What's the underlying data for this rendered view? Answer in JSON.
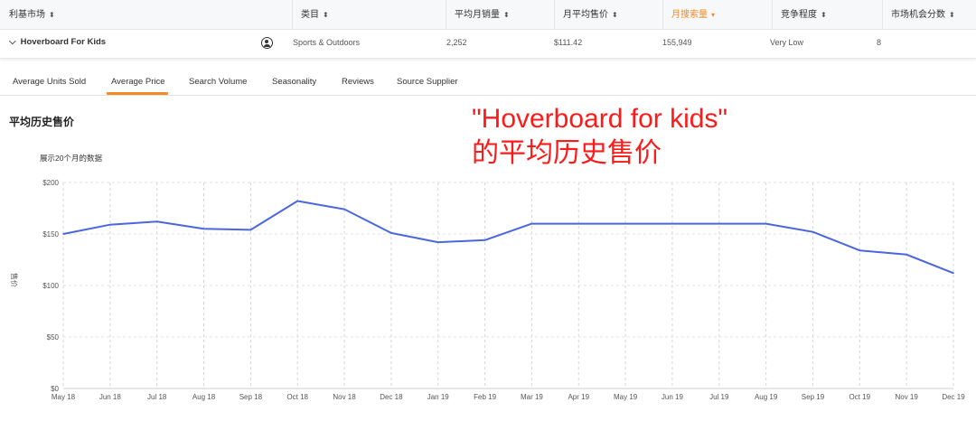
{
  "table": {
    "headers": [
      {
        "label": "利基市场",
        "sort": "⬍"
      },
      {
        "label": "类目",
        "sort": "⬍"
      },
      {
        "label": "平均月销量",
        "sort": "⬍"
      },
      {
        "label": "月平均售价",
        "sort": "⬍"
      },
      {
        "label": "月搜索量",
        "sort": "▾"
      },
      {
        "label": "竞争程度",
        "sort": "⬍"
      },
      {
        "label": "市场机会分数",
        "sort": "⬍"
      }
    ],
    "row": {
      "chevron": "⌵",
      "name": "Hoverboard For Kids",
      "icon": "person-circle-icon",
      "category": "Sports & Outdoors",
      "avg_units": "2,252",
      "avg_price": "$111.42",
      "search_volume": "155,949",
      "competition": "Very Low",
      "opportunity_score": "8"
    },
    "active_color": "#f08a24"
  },
  "tabs": [
    {
      "label": "Average Units Sold",
      "active": false
    },
    {
      "label": "Average Price",
      "active": true
    },
    {
      "label": "Search Volume",
      "active": false
    },
    {
      "label": "Seasonality",
      "active": false
    },
    {
      "label": "Reviews",
      "active": false
    },
    {
      "label": "Source Supplier",
      "active": false
    }
  ],
  "section_title": "平均历史售价",
  "annotation": {
    "text": "\"Hoverboard for kids\"\n的平均历史售价",
    "color": "#ff1a1a"
  },
  "chart_subtitle": "展示20个月的数据",
  "chart_data": {
    "type": "line",
    "categories": [
      "May 18",
      "Jun 18",
      "Jul 18",
      "Aug 18",
      "Sep 18",
      "Oct 18",
      "Nov 18",
      "Dec 18",
      "Jan 19",
      "Feb 19",
      "Mar 19",
      "Apr 19",
      "May 19",
      "Jun 19",
      "Jul 19",
      "Aug 19",
      "Sep 19",
      "Oct 19",
      "Nov 19",
      "Dec 19"
    ],
    "series": [
      {
        "values": [
          150,
          159,
          162,
          155,
          154,
          182,
          174,
          151,
          142,
          144,
          160,
          160,
          160,
          160,
          160,
          160,
          152,
          134,
          130,
          112
        ],
        "color": "#4a67e0"
      }
    ],
    "y_ticks": [
      "$0",
      "$50",
      "$100",
      "$150",
      "$200"
    ],
    "ylim": [
      0,
      200
    ],
    "ylabel": "售价",
    "grid": "dashed vertical and horizontal"
  }
}
